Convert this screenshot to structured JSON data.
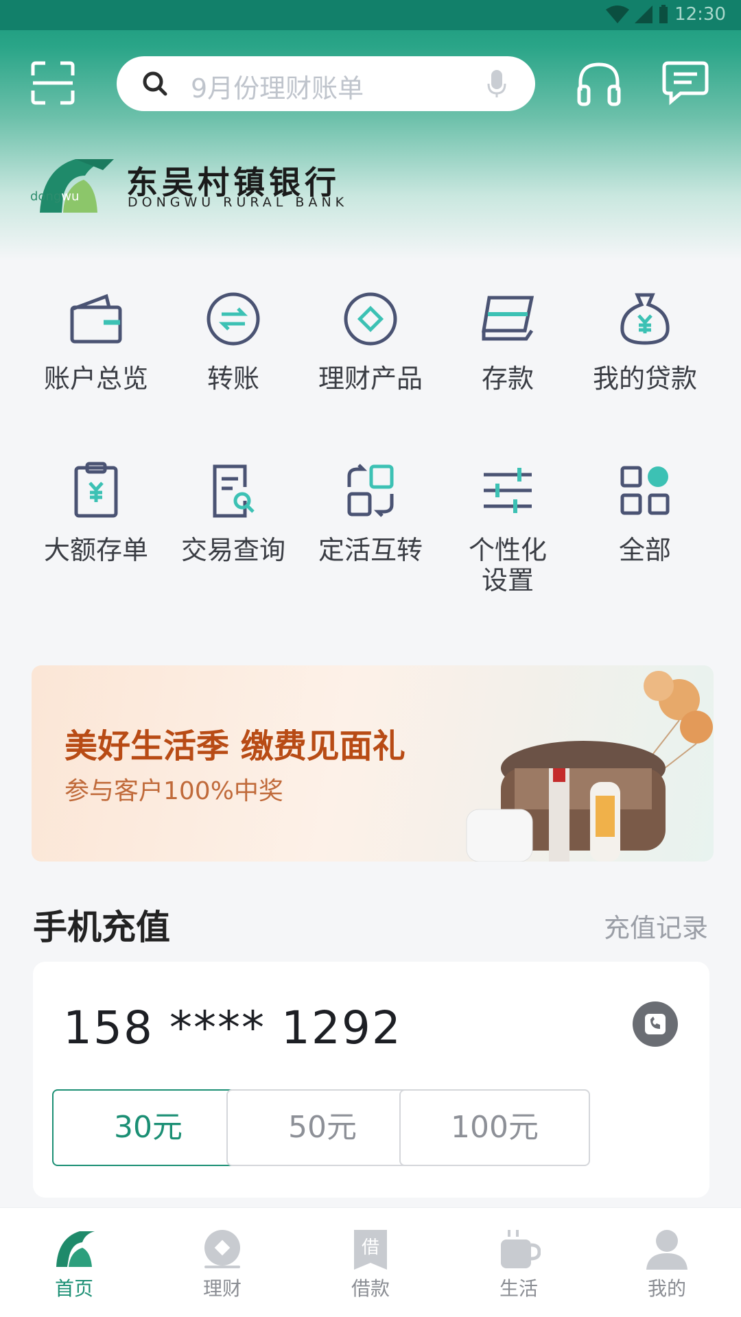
{
  "status_bar": {
    "time": "12:30"
  },
  "search": {
    "placeholder": "9月份理财账单"
  },
  "brand": {
    "name_cn": "东吴村镇银行",
    "name_en": "DONGWU RURAL BANK",
    "logo_text_a": "dong",
    "logo_text_b": "wu"
  },
  "services": [
    {
      "label": "账户总览",
      "icon": "wallet-icon"
    },
    {
      "label": "转账",
      "icon": "transfer-icon"
    },
    {
      "label": "理财产品",
      "icon": "wealth-icon"
    },
    {
      "label": "存款",
      "icon": "deposit-card-icon"
    },
    {
      "label": "我的贷款",
      "icon": "money-bag-icon"
    },
    {
      "label": "大额存单",
      "icon": "clipboard-yen-icon"
    },
    {
      "label": "交易查询",
      "icon": "doc-search-icon"
    },
    {
      "label": "定活互转",
      "icon": "swap-icon"
    },
    {
      "label": "个性化\n设置",
      "icon": "sliders-icon"
    },
    {
      "label": "全部",
      "icon": "all-grid-icon"
    }
  ],
  "banner": {
    "title": "美好生活季 缴费见面礼",
    "subtitle": "参与客户100%中奖"
  },
  "recharge": {
    "title": "手机充值",
    "link": "充值记录",
    "phone": "158 **** 1292",
    "amounts": [
      "30元",
      "50元",
      "100元"
    ],
    "selected": 0
  },
  "tabbar": {
    "items": [
      {
        "label": "首页",
        "icon": "home-logo-icon",
        "active": true
      },
      {
        "label": "理财",
        "icon": "wealth-tab-icon",
        "active": false
      },
      {
        "label": "借款",
        "icon": "loan-tab-icon",
        "active": false
      },
      {
        "label": "生活",
        "icon": "cup-icon",
        "active": false
      },
      {
        "label": "我的",
        "icon": "user-icon",
        "active": false
      }
    ]
  },
  "colors": {
    "primary": "#1b8f74",
    "accent": "#3cc1b4",
    "icon": "#4a5373"
  }
}
